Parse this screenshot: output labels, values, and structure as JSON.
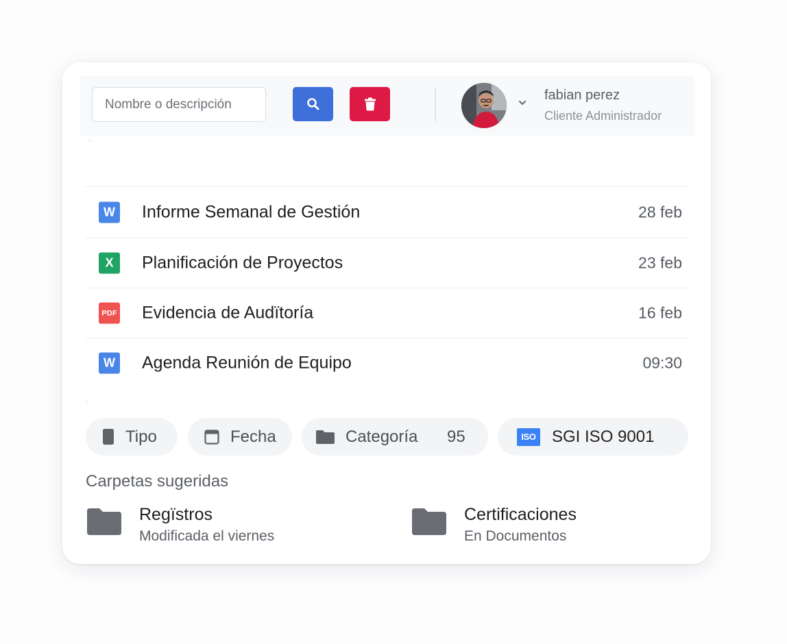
{
  "search": {
    "placeholder": "Nombre o descripción"
  },
  "colors": {
    "search_button": "#3f6fd9",
    "delete_button": "#dd1a45",
    "word": "#4a86e8",
    "excel": "#20a464",
    "pdf": "#ef5350",
    "iso": "#3b82f6"
  },
  "user": {
    "name": "fabian perez",
    "role": "Cliente Administrador"
  },
  "files": [
    {
      "type": "word",
      "icon_text": "W",
      "name": "Informe Semanal de Gestión",
      "date": "28 feb"
    },
    {
      "type": "excel",
      "icon_text": "X",
      "name": "Planificación de Proyectos",
      "date": "23 feb"
    },
    {
      "type": "pdf",
      "icon_text": "PDF",
      "name": "Evidencia de Audïtoría",
      "date": "16 feb"
    },
    {
      "type": "word",
      "icon_text": "W",
      "name": "Agenda Reunión de Equipo",
      "date": "09:30"
    }
  ],
  "filters": {
    "tipo": "Tipo",
    "fecha": "Fecha",
    "categoria": "Categoría",
    "categoria_count": "95",
    "iso_badge": "ISO",
    "iso": "SGI ISO 9001"
  },
  "suggested": {
    "title": "Carpetas sugeridas",
    "folders": [
      {
        "name": "Regïstros",
        "subtitle": "Modificada el viernes"
      },
      {
        "name": "Certificaciones",
        "subtitle": "En Documentos"
      }
    ]
  }
}
